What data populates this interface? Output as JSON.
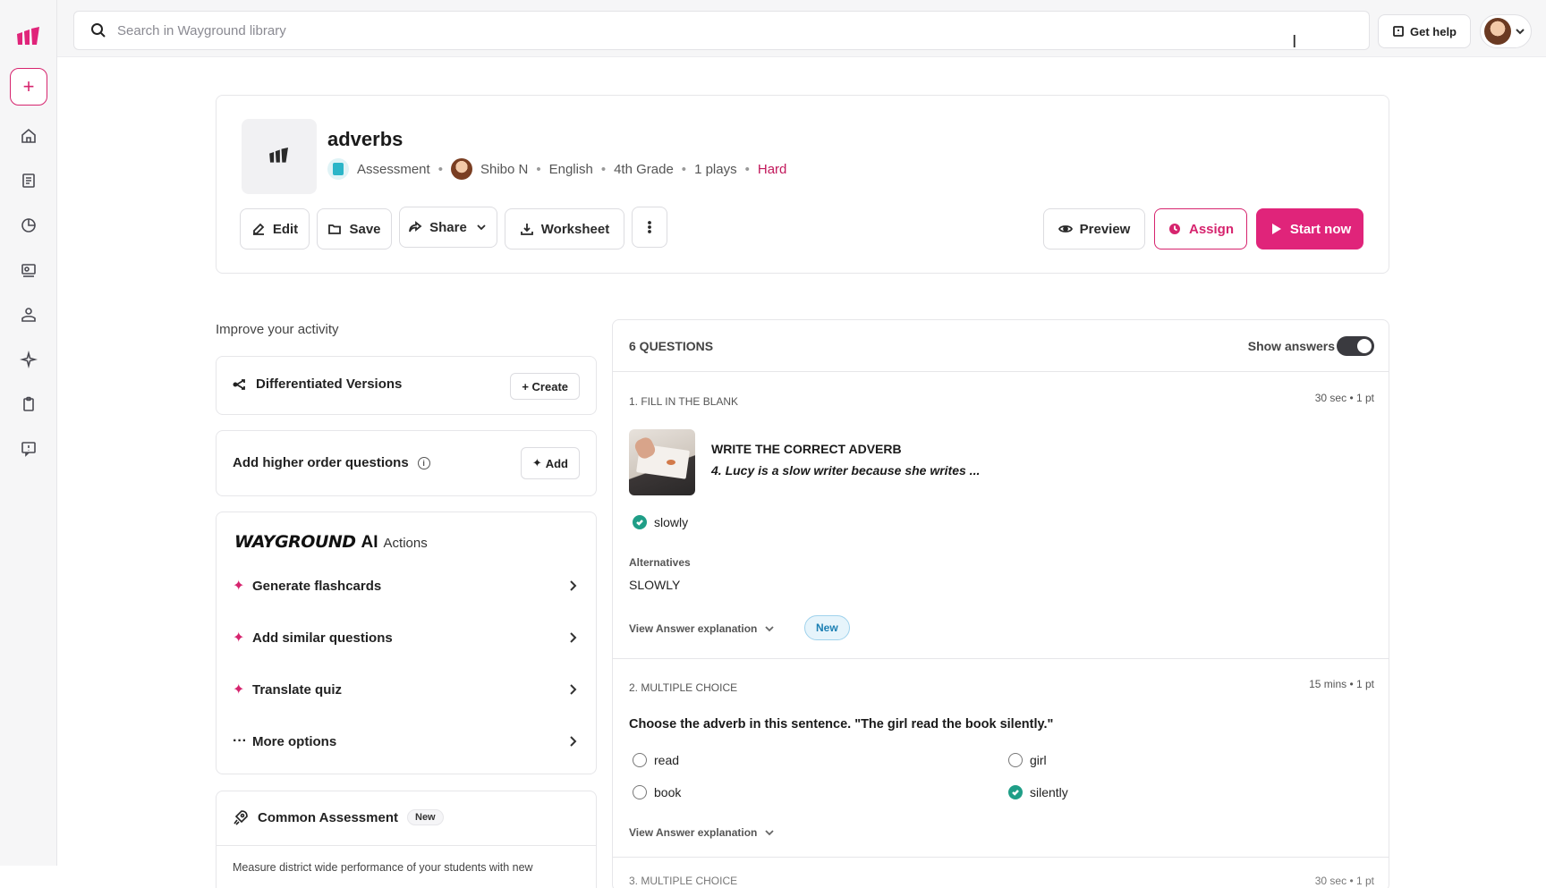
{
  "search": {
    "placeholder": "Search in Wayground library"
  },
  "topbar": {
    "help_label": "Get help"
  },
  "sidebar": {
    "items": [
      {
        "icon": "home-icon"
      },
      {
        "icon": "library-icon"
      },
      {
        "icon": "reports-icon"
      },
      {
        "icon": "classes-icon"
      },
      {
        "icon": "accommodations-icon"
      },
      {
        "icon": "ai-sparkle-icon"
      },
      {
        "icon": "clipboard-icon"
      },
      {
        "icon": "feedback-icon"
      }
    ]
  },
  "quiz": {
    "title": "adverbs",
    "type": "Assessment",
    "author": "Shibo N",
    "subject": "English",
    "grade": "4th Grade",
    "plays": "1 plays",
    "difficulty": "Hard"
  },
  "toolbar": {
    "edit": "Edit",
    "save": "Save",
    "share": "Share",
    "worksheet": "Worksheet",
    "preview": "Preview",
    "assign": "Assign",
    "start": "Start now"
  },
  "improve": {
    "heading": "Improve your activity",
    "differentiated": "Differentiated Versions",
    "create": "+ Create",
    "higher_order": "Add higher order questions",
    "add": "Add",
    "brand_word": "WAYGROUND",
    "brand_ai": "AI",
    "brand_actions": "Actions",
    "actions": [
      {
        "label": "Generate flashcards",
        "icon": "sparkle-icon"
      },
      {
        "label": "Add similar questions",
        "icon": "sparkle-icon"
      },
      {
        "label": "Translate quiz",
        "icon": "sparkle-icon"
      },
      {
        "label": "More options",
        "icon": "ellipsis-icon"
      }
    ],
    "common_title": "Common Assessment",
    "common_badge": "New",
    "common_desc": "Measure district wide performance of your students with new"
  },
  "questions": {
    "count_label": "6 QUESTIONS",
    "show_answers": "Show answers",
    "show_answers_on": true,
    "q1": {
      "type": "1. FILL IN THE BLANK",
      "time": "30 sec • 1 pt",
      "title": "WRITE THE CORRECT ADVERB",
      "prompt": "4. Lucy is a slow writer because she writes ...",
      "answer": "slowly",
      "alt_label": "Alternatives",
      "alt_value": "SLOWLY",
      "view_exp": "View Answer explanation",
      "new_badge": "New"
    },
    "q2": {
      "type": "2. MULTIPLE CHOICE",
      "time": "15 mins • 1 pt",
      "prompt": "Choose the adverb in this sentence. \"The girl read the book silently.\"",
      "options": [
        {
          "label": "read",
          "correct": false
        },
        {
          "label": "girl",
          "correct": false
        },
        {
          "label": "book",
          "correct": false
        },
        {
          "label": "silently",
          "correct": true
        }
      ],
      "view_exp": "View Answer explanation"
    },
    "q3_peek": {
      "type": "3. MULTIPLE CHOICE",
      "time": "30 sec • 1 pt"
    }
  },
  "colors": {
    "brand": "#e0247a",
    "correct": "#1f9e87",
    "hard": "#c2185b"
  }
}
